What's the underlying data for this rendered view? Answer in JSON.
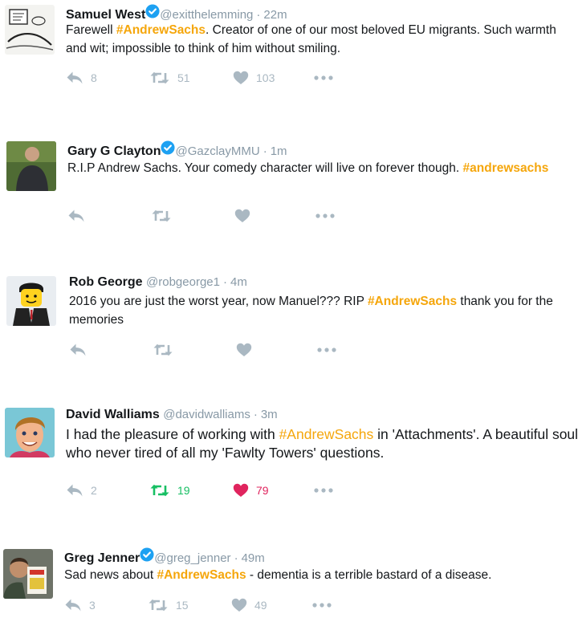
{
  "colors": {
    "hashtag": "#f5a60b",
    "verified": "#1da1f2",
    "meta_gray": "#8899a6",
    "icon_gray": "#aab8c2",
    "retweeted": "#17bf63",
    "liked": "#e0245e"
  },
  "tweets": [
    {
      "name": "Samuel West",
      "verified": true,
      "handle": "@exitthelemming",
      "time": "22m",
      "avatar": "cartoon-sketch-avatar",
      "text": [
        {
          "t": "Farewell "
        },
        {
          "t": "#AndrewSachs",
          "hashtag": true
        },
        {
          "t": ". Creator of one of our most beloved EU migrants. Such warmth and wit; impossible to think of him without smiling."
        }
      ],
      "reply": "8",
      "retweet": "51",
      "like": "103",
      "retweeted": false,
      "liked": false
    },
    {
      "name": "Gary G Clayton",
      "verified": true,
      "handle": "@GazclayMMU",
      "time": "1m",
      "avatar": "man-photo-avatar",
      "text": [
        {
          "t": "R.I.P Andrew Sachs. Your comedy character will live on forever though. "
        },
        {
          "t": "#andrewsachs",
          "hashtag": true
        }
      ],
      "reply": "",
      "retweet": "",
      "like": "",
      "retweeted": false,
      "liked": false
    },
    {
      "name": "Rob George",
      "verified": false,
      "handle": "@robgeorge1",
      "time": "4m",
      "avatar": "lego-figure-avatar",
      "text": [
        {
          "t": "2016 you are just the worst year, now Manuel??? RIP "
        },
        {
          "t": "#AndrewSachs",
          "hashtag": true
        },
        {
          "t": " thank you for the memories"
        }
      ],
      "reply": "",
      "retweet": "",
      "like": "",
      "retweeted": false,
      "liked": false
    },
    {
      "name": "David Walliams",
      "verified": false,
      "handle": "@davidwalliams",
      "time": "3m",
      "avatar": "cartoon-portrait-avatar",
      "text": [
        {
          "t": "I had the pleasure of working with "
        },
        {
          "t": "#AndrewSachs",
          "hashtag": false
        },
        {
          "t": " in 'Attachments'. A beautiful soul who never tired of all my 'Fawlty Towers' questions."
        }
      ],
      "reply": "2",
      "retweet": "19",
      "like": "79",
      "retweeted": true,
      "liked": true
    },
    {
      "name": "Greg Jenner",
      "verified": true,
      "handle": "@greg_jenner",
      "time": "49m",
      "avatar": "man-with-book-avatar",
      "text": [
        {
          "t": "Sad news about "
        },
        {
          "t": "#AndrewSachs",
          "hashtag": true
        },
        {
          "t": " - dementia is a terrible bastard of a disease."
        }
      ],
      "reply": "3",
      "retweet": "15",
      "like": "49",
      "retweeted": false,
      "liked": false
    }
  ]
}
